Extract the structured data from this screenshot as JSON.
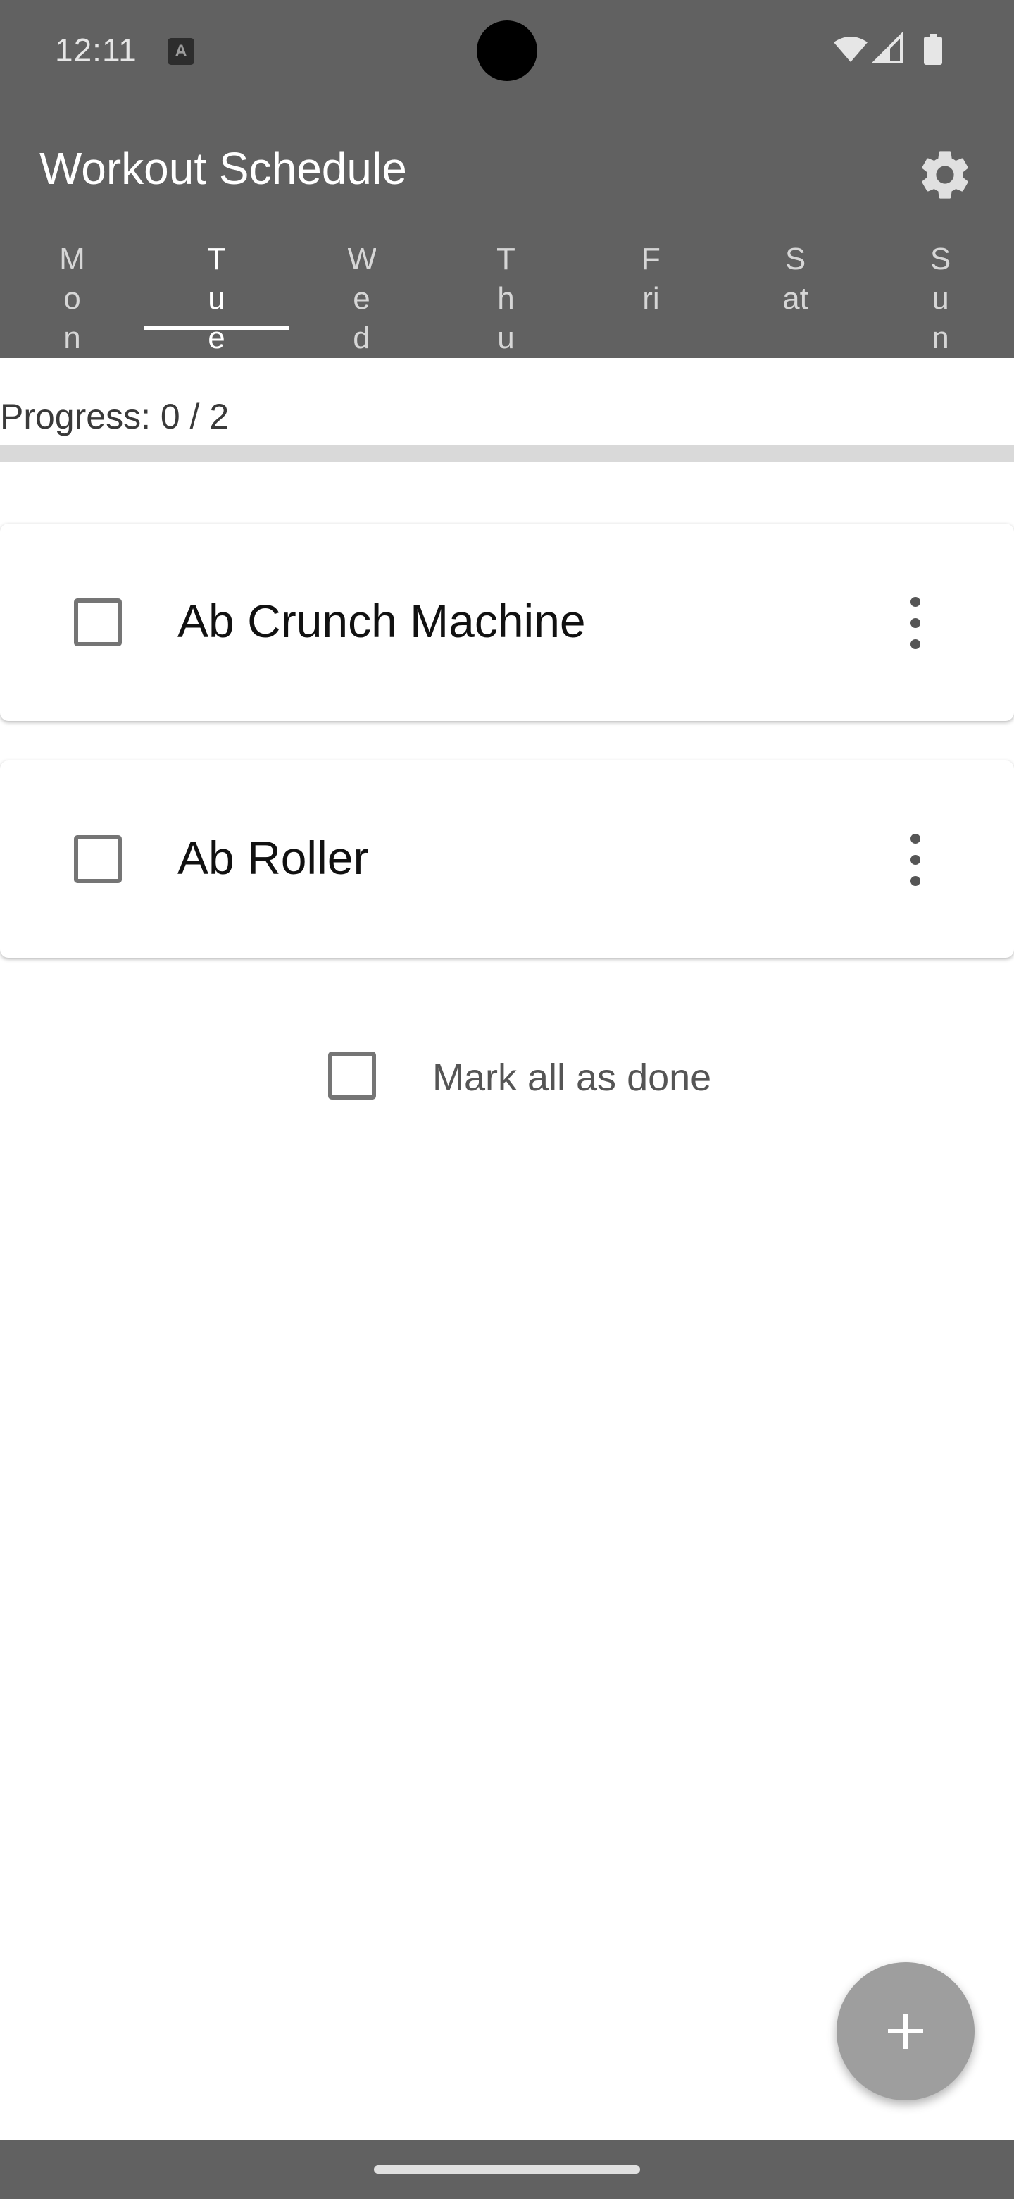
{
  "status_bar": {
    "time": "12:11",
    "notification_icon": "text-a-icon",
    "icons": [
      "wifi-icon",
      "signal-icon",
      "battery-icon"
    ]
  },
  "app_bar": {
    "title": "Workout Schedule",
    "settings_icon": "gear-icon",
    "background": "#616161"
  },
  "tabs": [
    {
      "label": "Mon",
      "active": false
    },
    {
      "label": "Tue",
      "active": true
    },
    {
      "label": "Wed",
      "active": false
    },
    {
      "label": "Thu",
      "active": false
    },
    {
      "label": "Fri",
      "active": false
    },
    {
      "label": "Sat",
      "active": false
    },
    {
      "label": "Sun",
      "active": false
    }
  ],
  "progress": {
    "text": "Progress: 0 / 2",
    "completed": 0,
    "total": 2
  },
  "exercises": [
    {
      "name": "Ab Crunch Machine",
      "done": false
    },
    {
      "name": "Ab Roller",
      "done": false
    }
  ],
  "mark_all": {
    "label": "Mark all as done",
    "checked": false
  },
  "fab": {
    "icon": "plus-icon",
    "color": "#9e9e9e"
  }
}
